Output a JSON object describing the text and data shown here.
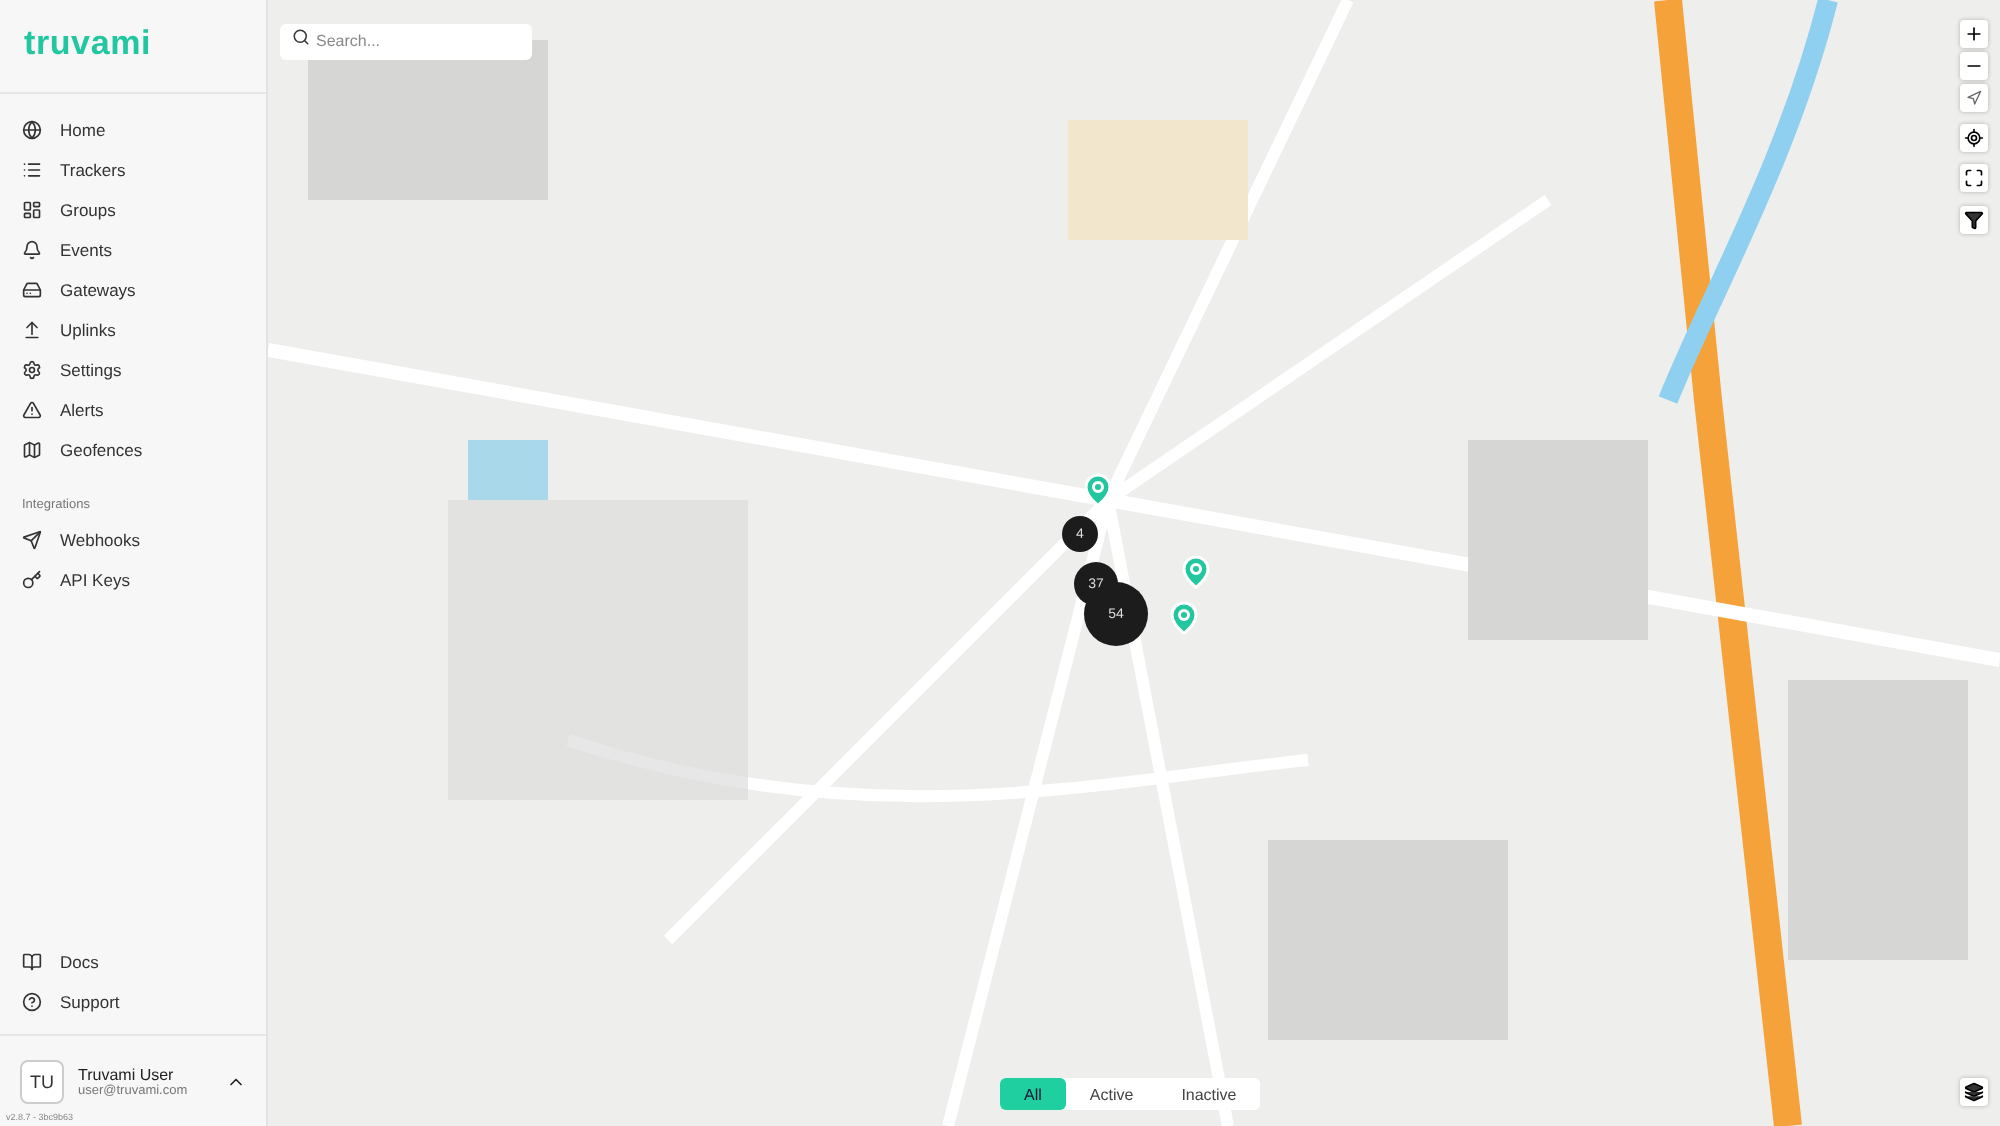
{
  "brand": "truvami",
  "nav": [
    "Home",
    "Trackers",
    "Groups",
    "Events",
    "Gateways",
    "Uplinks",
    "Settings",
    "Alerts",
    "Geofences"
  ],
  "integrations": {
    "title": "Integrations",
    "items": [
      "Webhooks",
      "API Keys"
    ]
  },
  "footer_links": [
    "Docs",
    "Support"
  ],
  "user": {
    "initials": "TU",
    "name": "Truvami User",
    "email": "user@truvami.com"
  },
  "version": "v2.8.7 - 3bc9b63",
  "search": {
    "placeholder": "Search..."
  },
  "clusters": [
    {
      "count": "4"
    },
    {
      "count": "37"
    },
    {
      "count": "54"
    }
  ],
  "filters": [
    {
      "label": "All",
      "selected": true
    },
    {
      "label": "Active",
      "selected": false
    },
    {
      "label": "Inactive",
      "selected": false
    }
  ]
}
